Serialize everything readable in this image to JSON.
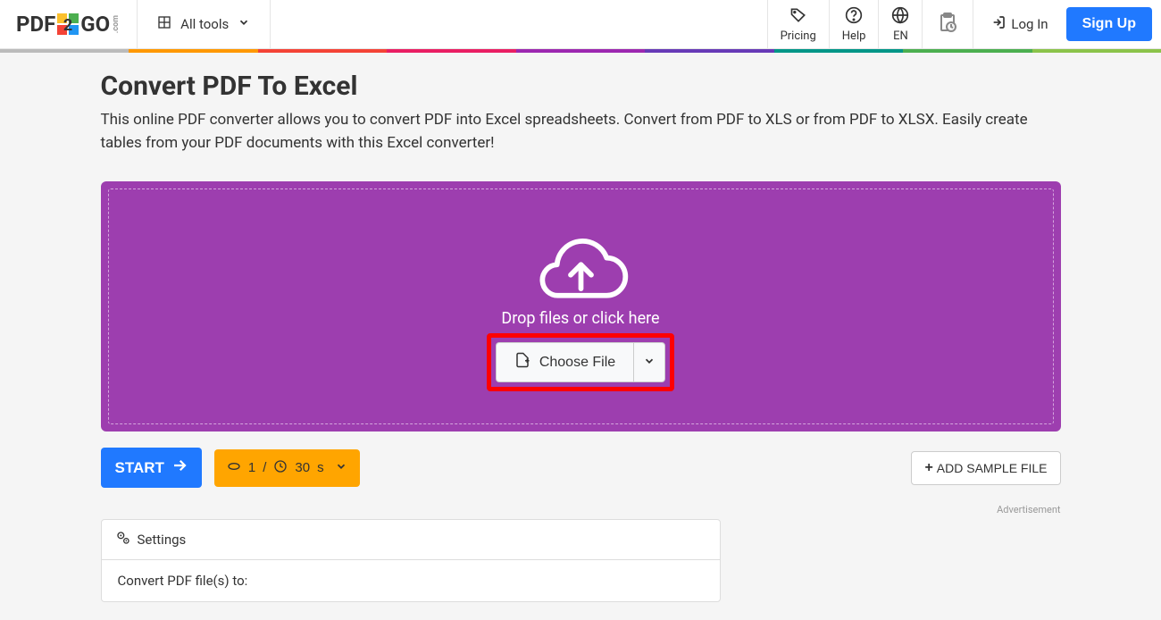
{
  "header": {
    "logo_pdf": "PDF",
    "logo_2": "2",
    "logo_go": "GO",
    "logo_com": ".com",
    "all_tools": "All tools",
    "pricing": "Pricing",
    "help": "Help",
    "language": "EN",
    "login": "Log In",
    "signup": "Sign Up"
  },
  "rainbow_colors": [
    "#bbbbbb",
    "#ff9800",
    "#f44336",
    "#e91e63",
    "#9c27b0",
    "#673ab7",
    "#009688",
    "#4caf50",
    "#8bc34a"
  ],
  "page": {
    "title": "Convert PDF To Excel",
    "description": "This online PDF converter allows you to convert PDF into Excel spreadsheets. Convert from PDF to XLS or from PDF to XLSX. Easily create tables from your PDF documents with this Excel converter!"
  },
  "dropzone": {
    "drop_text": "Drop files or click here",
    "choose_file": "Choose File"
  },
  "actions": {
    "start": "START",
    "credits": "1",
    "credits_sep": "/",
    "duration_value": "30",
    "duration_unit": "s",
    "add_sample": "ADD SAMPLE FILE"
  },
  "ad_label": "Advertisement",
  "settings": {
    "title": "Settings",
    "convert_label": "Convert PDF file(s) to:"
  }
}
